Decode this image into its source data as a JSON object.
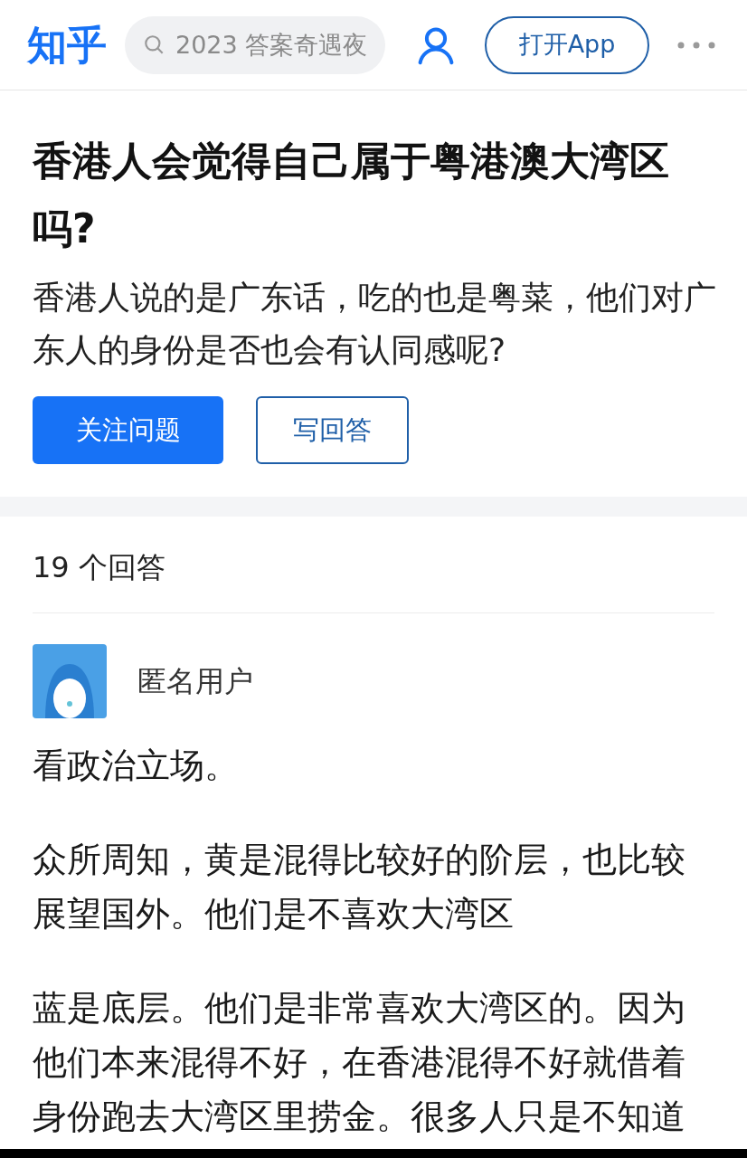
{
  "header": {
    "logo": "知乎",
    "search": {
      "placeholder": "2023 答案奇遇夜"
    },
    "open_app_button": "打开App"
  },
  "question": {
    "title": "香港人会觉得自己属于粤港澳大湾区吗?",
    "description": "香港人说的是广东话，吃的也是粤菜，他们对广东人的身份是否也会有认同感呢?",
    "buttons": [
      {
        "label": "关注问题",
        "kind": "primary"
      },
      {
        "label": "写回答",
        "kind": "outline"
      }
    ]
  },
  "answers": {
    "count": "19 个回答",
    "author": "匿名用户",
    "paragraphs": [
      "看政治立场。",
      "众所周知，黄是混得比较好的阶层，也比较展望国外。他们是不喜欢大湾区",
      "蓝是底层。他们是非常喜欢大湾区的。因为他们本来混得不好，在香港混得不好就借着身份跑去大湾区里捞金。很多人只是不知道"
    ]
  }
}
